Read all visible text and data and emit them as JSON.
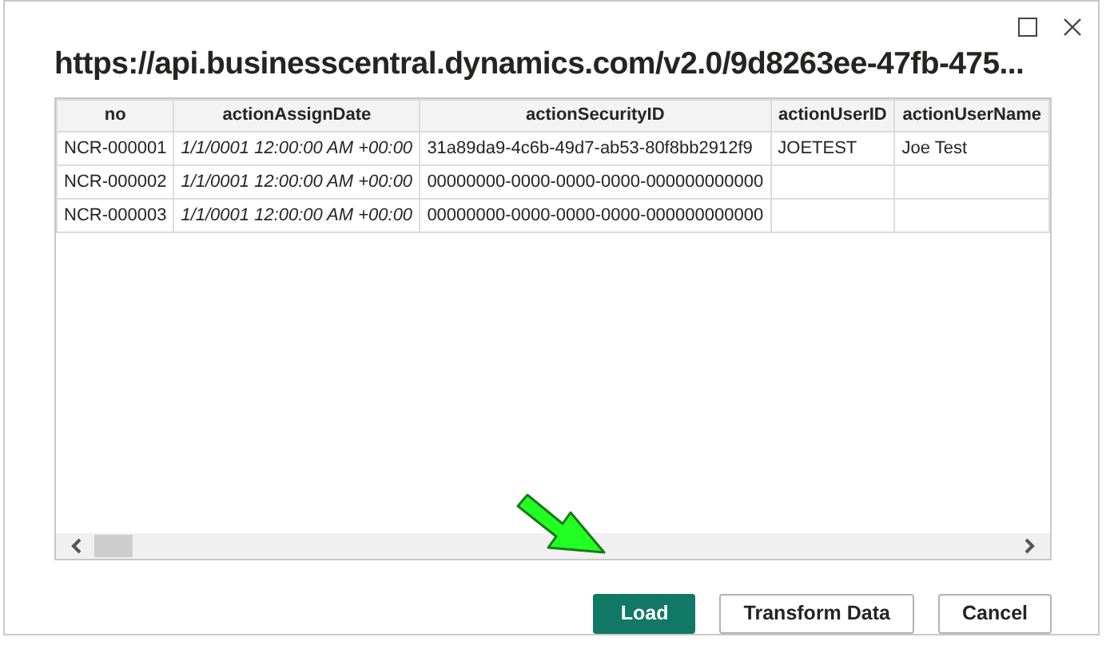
{
  "window": {
    "title": "https://api.businesscentral.dynamics.com/v2.0/9d8263ee-47fb-475..."
  },
  "table": {
    "columns": [
      "no",
      "actionAssignDate",
      "actionSecurityID",
      "actionUserID",
      "actionUserName"
    ],
    "rows": [
      [
        "NCR-000001",
        "1/1/0001 12:00:00 AM +00:00",
        "31a89da9-4c6b-49d7-ab53-80f8bb2912f9",
        "JOETEST",
        "Joe Test"
      ],
      [
        "NCR-000002",
        "1/1/0001 12:00:00 AM +00:00",
        "00000000-0000-0000-0000-000000000000",
        "",
        ""
      ],
      [
        "NCR-000003",
        "1/1/0001 12:00:00 AM +00:00",
        "00000000-0000-0000-0000-000000000000",
        "",
        ""
      ]
    ]
  },
  "buttons": [
    {
      "label": "Load",
      "kind": "primary"
    },
    {
      "label": "Transform Data",
      "kind": "secondary"
    },
    {
      "label": "Cancel",
      "kind": "secondary"
    }
  ]
}
